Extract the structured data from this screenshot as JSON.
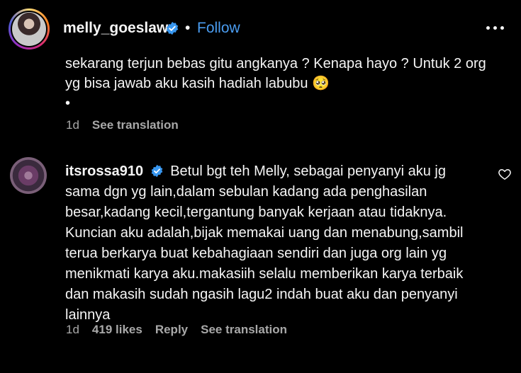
{
  "header": {
    "username": "melly_goeslaw",
    "separator": "•",
    "follow_label": "Follow",
    "avatar_icon": "profile-avatar",
    "verified_icon": "verified-badge-icon",
    "more_icon": "more-options-icon"
  },
  "caption": {
    "line1": "sekarang terjun bebas gitu angkanya ? Kenapa hayo ? Untuk 2 org",
    "line2": "yg bisa jawab aku kasih hadiah labubu 🥺",
    "line3": "•",
    "time": "1d",
    "see_translation": "See translation"
  },
  "comment": {
    "username": "itsrossa910",
    "lines": [
      "Betul bgt teh Melly, sebagai penyanyi aku jg",
      "sama dgn yg lain,dalam sebulan kadang ada penghasilan",
      "besar,kadang kecil,tergantung banyak kerjaan atau tidaknya.",
      "Kuncian aku adalah,bijak memakai uang dan menabung,sambil",
      "terua berkarya buat kebahagiaan sendiri dan juga org lain yg",
      "menikmati karya aku.makasiih selalu memberikan karya terbaik",
      "dan makasih sudah ngasih lagu2 indah buat aku dan penyanyi",
      "lainnya"
    ],
    "time": "1d",
    "likes": "419 likes",
    "reply": "Reply",
    "see_translation": "See translation"
  },
  "colors": {
    "background": "#000000",
    "text": "#f5f5f5",
    "secondary": "#a8a8a8",
    "link": "#4a9cf0",
    "verified": "#3897f0"
  }
}
